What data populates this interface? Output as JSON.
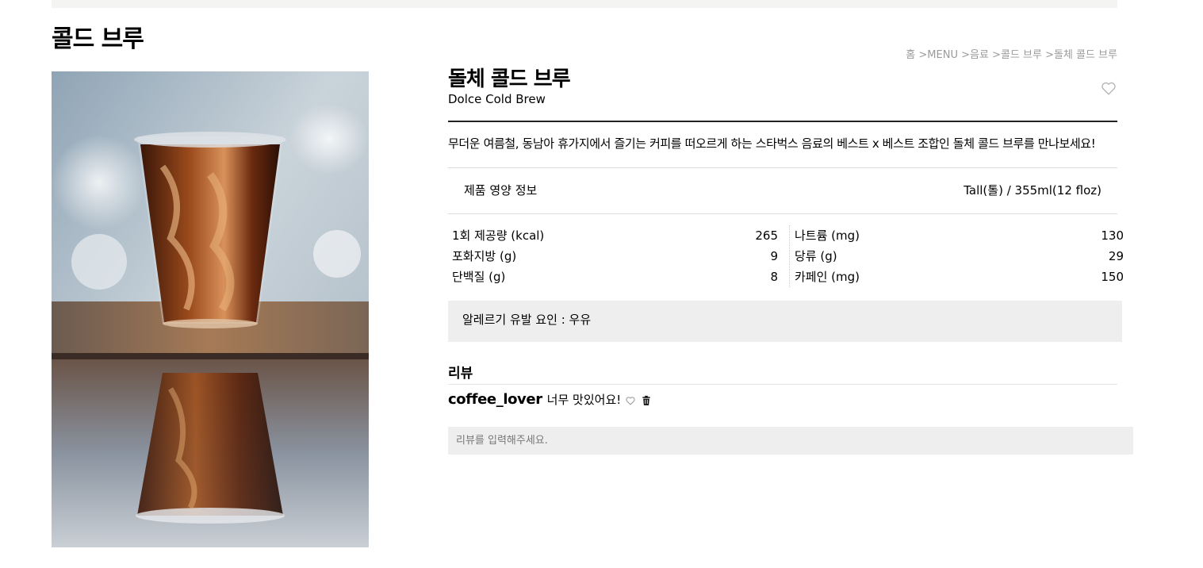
{
  "page": {
    "title": "콜드 브루"
  },
  "breadcrumb": {
    "items": [
      "홈",
      "MENU",
      "음료",
      "콜드 브루",
      "돌체 콜드 브루"
    ],
    "separator": " >"
  },
  "product": {
    "name_ko": "돌체 콜드 브루",
    "name_en": "Dolce Cold Brew",
    "description": "무더운 여름철, 동남아 휴가지에서 즐기는 커피를 떠오르게 하는 스타벅스 음료의 베스트 x 베스트 조합인 돌체 콜드 브루를 만나보세요!",
    "favorite_icon": "heart-outline-icon"
  },
  "nutrition": {
    "header_label": "제품 영양 정보",
    "size": "Tall(톨) / 355ml(12 floz)",
    "left": [
      {
        "label": "1회 제공량 (kcal)",
        "value": "265"
      },
      {
        "label": "포화지방 (g)",
        "value": "9"
      },
      {
        "label": "단백질 (g)",
        "value": "8"
      }
    ],
    "right": [
      {
        "label": "나트륨 (mg)",
        "value": "130"
      },
      {
        "label": "당류 (g)",
        "value": "29"
      },
      {
        "label": "카페인 (mg)",
        "value": "150"
      }
    ]
  },
  "allergy": {
    "text": "알레르기 유발 요인 : 우유"
  },
  "reviews": {
    "title": "리뷰",
    "items": [
      {
        "user": "coffee_lover",
        "text": "너무 맛있어요!",
        "like_icon": "heart-outline-icon",
        "delete_icon": "trash-icon"
      }
    ],
    "input_placeholder": "리뷰를 입력해주세요."
  },
  "colors": {
    "text": "#000000",
    "muted": "#9a9a9a",
    "panel": "#eeeeee",
    "top_strip": "#f4f4f2"
  }
}
